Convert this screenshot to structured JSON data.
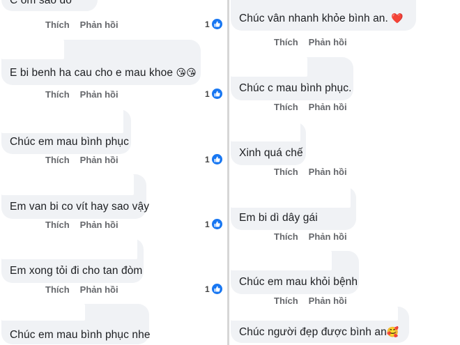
{
  "actions": {
    "like_label": "Thích",
    "reply_label": "Phản hồi"
  },
  "left_comments": [
    {
      "text": "C ôm sao đó",
      "reaction_count": "1"
    },
    {
      "text": "E bi benh ha cau cho e mau khoe",
      "emoji": "😘😘",
      "reaction_count": "1"
    },
    {
      "text": "Chúc em mau bình phục",
      "reaction_count": "1"
    },
    {
      "text": "Em van bi co vít hay sao vậy",
      "reaction_count": "1"
    },
    {
      "text": "Em xong tỏi đi cho tan đòm",
      "reaction_count": "1"
    },
    {
      "text": "Chúc em mau bình phục nhe"
    }
  ],
  "right_comments": [
    {
      "text": "Chúc vân nhanh khỏe bình an.",
      "emoji": "❤️"
    },
    {
      "text": "Chúc c mau bình phục."
    },
    {
      "text": "Xinh quá chế"
    },
    {
      "text": "Em bi dì dây gái"
    },
    {
      "text": "Chúc em mau khỏi bệnh"
    },
    {
      "text": "Chúc người đẹp được bình an",
      "emoji": "🥰"
    }
  ],
  "colors": {
    "bubble": "#f0f2f5",
    "like_blue": "#1877f2",
    "action_gray": "#65676b"
  }
}
